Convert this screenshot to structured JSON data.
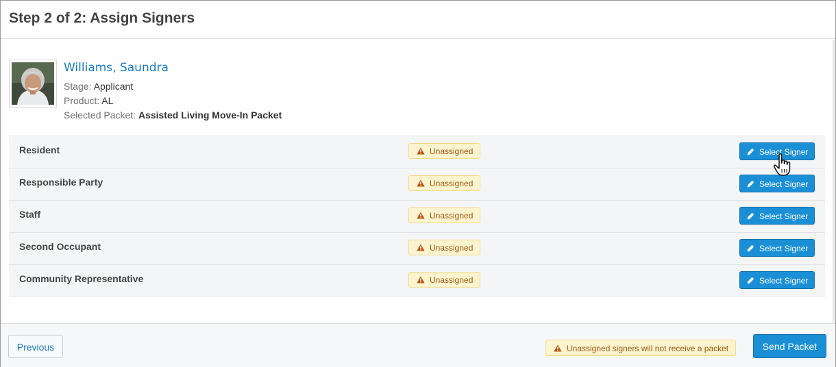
{
  "modal": {
    "title": "Step 2 of 2: Assign Signers"
  },
  "profile": {
    "name": "Williams, Saundra",
    "stage_label": "Stage:",
    "stage_value": "Applicant",
    "product_label": "Product:",
    "product_value": "AL",
    "packet_label": "Selected Packet:",
    "packet_value": "Assisted Living Move-In Packet"
  },
  "signers": [
    {
      "role": "Resident",
      "status": "Unassigned",
      "action": "Select Signer"
    },
    {
      "role": "Responsible Party",
      "status": "Unassigned",
      "action": "Select Signer"
    },
    {
      "role": "Staff",
      "status": "Unassigned",
      "action": "Select Signer"
    },
    {
      "role": "Second Occupant",
      "status": "Unassigned",
      "action": "Select Signer"
    },
    {
      "role": "Community Representative",
      "status": "Unassigned",
      "action": "Select Signer"
    }
  ],
  "footer": {
    "previous_label": "Previous",
    "warning_text": "Unassigned signers will not receive a packet",
    "send_label": "Send Packet"
  },
  "icons": {
    "status": "warning-triangle-icon",
    "action": "pencil-icon",
    "cursor": "hand-pointer-icon"
  },
  "colors": {
    "primary": "#1a8fd6",
    "link": "#1b7bbf",
    "warning_bg": "#fcf3cf",
    "warning_text": "#9a5a10"
  }
}
